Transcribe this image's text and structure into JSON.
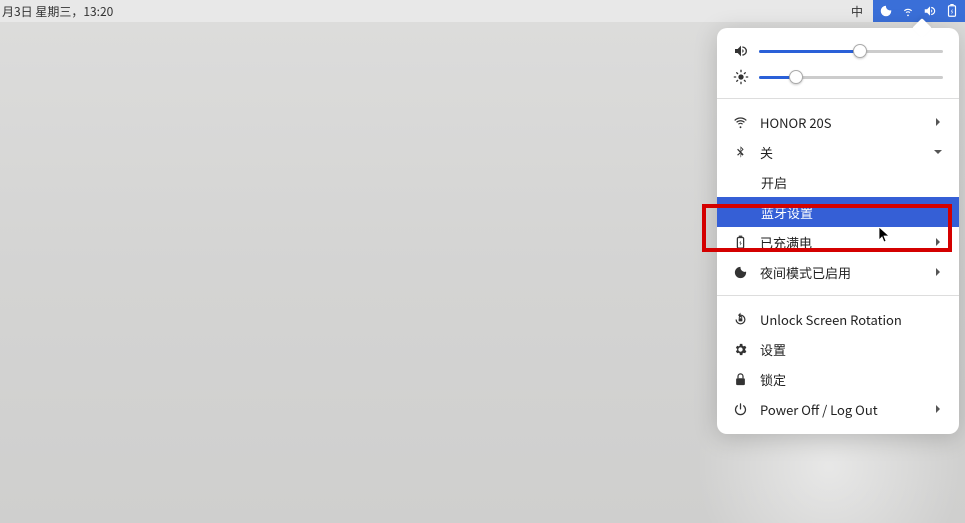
{
  "topbar": {
    "date_text": "月3日 星期三，13:20",
    "ime": "中"
  },
  "sliders": {
    "volume_percent": 55,
    "brightness_percent": 20
  },
  "menu": {
    "wifi_label": "HONOR 20S",
    "bluetooth_label": "关",
    "bluetooth_sub_on": "开启",
    "bluetooth_sub_settings": "蓝牙设置",
    "battery_label": "已充满电",
    "night_label": "夜间模式已启用",
    "rotation_label": "Unlock Screen Rotation",
    "settings_label": "设置",
    "lock_label": "锁定",
    "power_label": "Power Off / Log Out"
  }
}
